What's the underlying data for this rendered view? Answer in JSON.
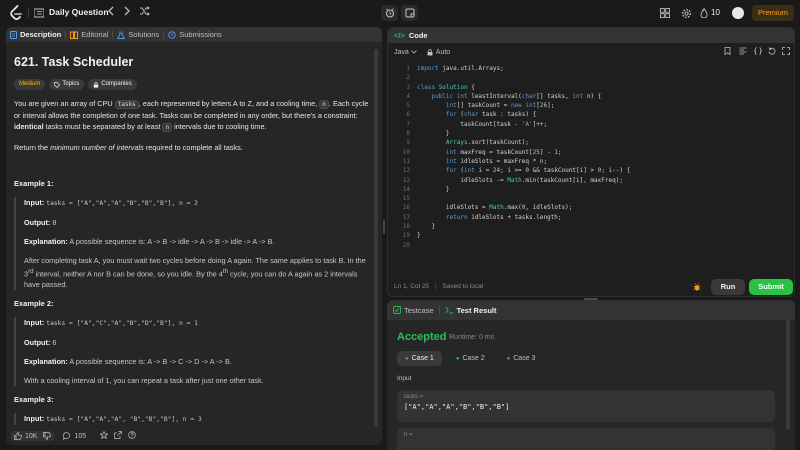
{
  "topbar": {
    "title": "Daily Question",
    "streak": "10",
    "premium": "Premium"
  },
  "tabs": {
    "description": "Description",
    "editorial": "Editorial",
    "solutions": "Solutions",
    "submissions": "Submissions"
  },
  "problem": {
    "title": "621. Task Scheduler",
    "difficulty": "Medium",
    "topics": "Topics",
    "companies": "Companies",
    "p1_a": "You are given an array of CPU ",
    "p1_code1": "tasks",
    "p1_b": ", each represented by letters A to Z, and a cooling time, ",
    "p1_code2": "n",
    "p1_c": ". Each cycle or interval allows the completion of one task. Tasks can be completed in any order, but there's a constraint: ",
    "p1_bold": "identical",
    "p1_d": " tasks must be separated by at least ",
    "p1_code3": "n",
    "p1_e": " intervals due to cooling time.",
    "p2_a": "Return the ",
    "p2_em": "minimum number of intervals",
    "p2_b": " required to complete all tasks.",
    "examples": [
      {
        "heading": "Example 1:",
        "input_label": "Input:",
        "input": "tasks = [\"A\",\"A\",\"A\",\"B\",\"B\",\"B\"], n = 2",
        "output_label": "Output:",
        "output": "8",
        "explanation_label": "Explanation:",
        "explanation": "A possible sequence is: A -> B -> idle -> A -> B -> idle -> A -> B.",
        "extra_a": "After completing task A, you must wait two cycles before doing A again. The same applies to task B. In the 3",
        "extra_sup1": "rd",
        "extra_b": " interval, neither A nor B can be done, so you idle. By the 4",
        "extra_sup2": "th",
        "extra_c": " cycle, you can do A again as 2 intervals have passed."
      },
      {
        "heading": "Example 2:",
        "input_label": "Input:",
        "input": "tasks = [\"A\",\"C\",\"A\",\"B\",\"D\",\"B\"], n = 1",
        "output_label": "Output:",
        "output": "6",
        "explanation_label": "Explanation:",
        "explanation": "A possible sequence is: A -> B -> C -> D -> A -> B.",
        "extra": "With a cooling interval of 1, you can repeat a task after just one other task."
      },
      {
        "heading": "Example 3:",
        "input_label": "Input:",
        "input": "tasks = [\"A\",\"A\",\"A\", \"B\",\"B\",\"B\"], n = 3"
      }
    ]
  },
  "bottom": {
    "likes": "10K",
    "comments": "105"
  },
  "code": {
    "header": "Code",
    "language": "Java",
    "mode": "Auto",
    "line_numbers": [
      "1",
      "2",
      "3",
      "4",
      "5",
      "6",
      "7",
      "8",
      "9",
      "10",
      "11",
      "12",
      "13",
      "14",
      "15",
      "16",
      "17",
      "18",
      "19",
      "20"
    ],
    "status": "Ln 1, Col 25",
    "saved": "Saved to local",
    "run": "Run",
    "submit": "Submit"
  },
  "result": {
    "testcase_tab": "Testcase",
    "result_tab": "Test Result",
    "status": "Accepted",
    "runtime": "Runtime: 0 ms",
    "cases": [
      "Case 1",
      "Case 2",
      "Case 3"
    ],
    "input_label": "Input",
    "tasks_key": "tasks =",
    "tasks_value": "[\"A\",\"A\",\"A\",\"B\",\"B\",\"B\"]",
    "n_key": "n ="
  },
  "colors": {
    "accepted": "#2cbb5d",
    "submit": "#28c244",
    "premium": "#ffa116",
    "medium": "#ffb800"
  }
}
